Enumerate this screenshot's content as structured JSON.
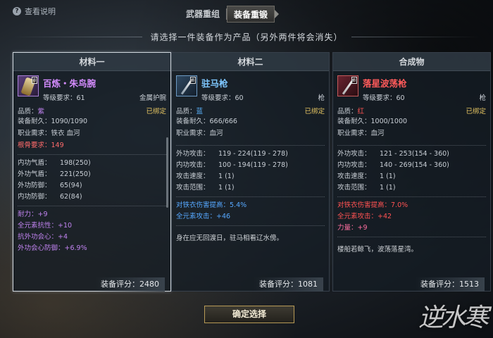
{
  "header": {
    "help_label": "查看说明",
    "help_icon": "?"
  },
  "tabs": [
    {
      "label": "武器重组"
    },
    {
      "label": "装备重锻"
    }
  ],
  "subtitle": "请选择一件装备作为产品（另外两件将会消失）",
  "panels": [
    {
      "title": "材料一",
      "badge": "8",
      "name": "百炼・朱鸟腕",
      "level_req": "等级要求：61",
      "type": "金属护腕",
      "quality_label": "品质：",
      "quality": "紫",
      "bound": "已绑定",
      "durability": "装备耐久：1090/1090",
      "job_req": "职业需求：铁衣 血河",
      "root_req": "根骨要求：149",
      "stats": [
        {
          "k": "内功气盾：",
          "v": "198(250)"
        },
        {
          "k": "外功气盾：",
          "v": "221(250)"
        },
        {
          "k": "外功防御：",
          "v": "65(94)"
        },
        {
          "k": "内功防御：",
          "v": "62(84)"
        }
      ],
      "bonuses": [
        {
          "text": "耐力：+9"
        },
        {
          "text": "全元素抗性：+10"
        },
        {
          "text": "抗外功会心：+4"
        },
        {
          "text": "外功会心防御：+6.9%"
        }
      ],
      "score": "装备评分：2480"
    },
    {
      "title": "材料二",
      "badge": "8",
      "name": "驻马枪",
      "level_req": "等级要求：60",
      "type": "枪",
      "quality_label": "品质：",
      "quality": "蓝",
      "bound": "已绑定",
      "durability": "装备耐久：666/666",
      "job_req": "职业需求：血河",
      "stats": [
        {
          "k": "外功攻击：",
          "v": "119 - 224(119 - 278)"
        },
        {
          "k": "内功攻击：",
          "v": "100 - 194(119 - 278)"
        },
        {
          "k": "攻击速度：",
          "v": "1 (1)"
        },
        {
          "k": "攻击范围：",
          "v": "1 (1)"
        }
      ],
      "bonuses": [
        {
          "text": "对铁衣伤害提高：5.4%"
        },
        {
          "text": "全元素攻击：+46"
        }
      ],
      "desc": "身在应无回渡日，驻马相看辽水傍。",
      "score": "装备评分：1081"
    },
    {
      "title": "合成物",
      "badge": "8",
      "name": "落星波荡枪",
      "level_req": "等级要求：60",
      "type": "枪",
      "quality_label": "品质：",
      "quality": "红",
      "bound": "已绑定",
      "durability": "装备耐久：1000/1000",
      "job_req": "职业需求：血河",
      "stats": [
        {
          "k": "外功攻击：",
          "v": "121 - 253(154 - 360)"
        },
        {
          "k": "内功攻击：",
          "v": "140 - 269(154 - 360)"
        },
        {
          "k": "攻击速度：",
          "v": "1 (1)"
        },
        {
          "k": "攻击范围：",
          "v": "1 (1)"
        }
      ],
      "bonuses": [
        {
          "text": "对铁衣伤害提高：7.0%"
        },
        {
          "text": "全元素攻击：+42"
        },
        {
          "text": "力量：+9"
        }
      ],
      "desc": "楼船若鲸飞，波荡落星湾。",
      "score": "装备评分：1513"
    }
  ],
  "confirm_label": "确定选择",
  "logo_text": "逆水寒",
  "colors": {
    "purple": "#d58cff",
    "blue": "#7ec7ff",
    "red": "#ff5a5a",
    "bound": "#e3c361"
  }
}
